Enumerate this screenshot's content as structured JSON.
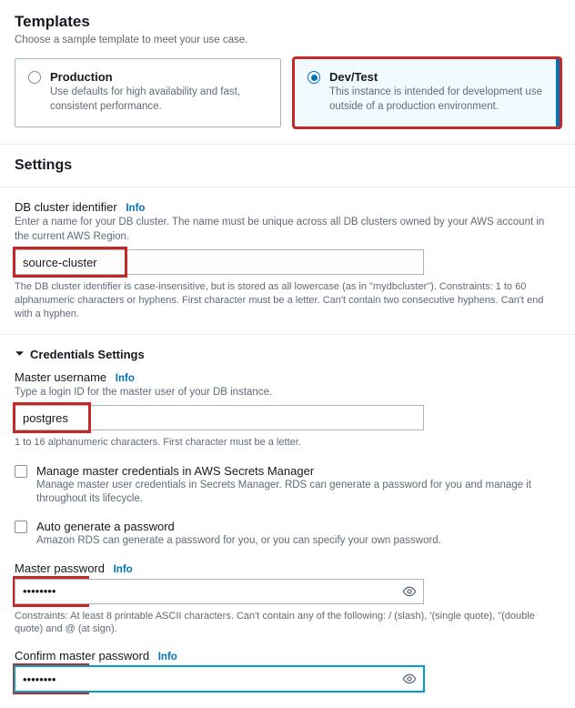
{
  "templates": {
    "heading": "Templates",
    "sub": "Choose a sample template to meet your use case.",
    "options": [
      {
        "title": "Production",
        "desc": "Use defaults for high availability and fast, consistent performance.",
        "selected": false
      },
      {
        "title": "Dev/Test",
        "desc": "This instance is intended for development use outside of a production environment.",
        "selected": true
      }
    ]
  },
  "settings": {
    "heading": "Settings",
    "cluster_id": {
      "label": "DB cluster identifier",
      "info": "Info",
      "help": "Enter a name for your DB cluster. The name must be unique across all DB clusters owned by your AWS account in the current AWS Region.",
      "value": "source-cluster",
      "constraint": "The DB cluster identifier is case-insensitive, but is stored as all lowercase (as in \"mydbcluster\"). Constraints: 1 to 60 alphanumeric characters or hyphens. First character must be a letter. Can't contain two consecutive hyphens. Can't end with a hyphen."
    },
    "credentials_header": "Credentials Settings",
    "master_user": {
      "label": "Master username",
      "info": "Info",
      "help": "Type a login ID for the master user of your DB instance.",
      "value": "postgres",
      "constraint": "1 to 16 alphanumeric characters. First character must be a letter."
    },
    "secrets_checkbox": {
      "title": "Manage master credentials in AWS Secrets Manager",
      "desc": "Manage master user credentials in Secrets Manager. RDS can generate a password for you and manage it throughout its lifecycle."
    },
    "auto_checkbox": {
      "title": "Auto generate a password",
      "desc": "Amazon RDS can generate a password for you, or you can specify your own password."
    },
    "master_pw": {
      "label": "Master password",
      "info": "Info",
      "value": "••••••••",
      "constraint": "Constraints: At least 8 printable ASCII characters. Can't contain any of the following: / (slash), '(single quote), \"(double quote) and @ (at sign)."
    },
    "confirm_pw": {
      "label": "Confirm master password",
      "info": "Info",
      "value": "••••••••"
    }
  }
}
